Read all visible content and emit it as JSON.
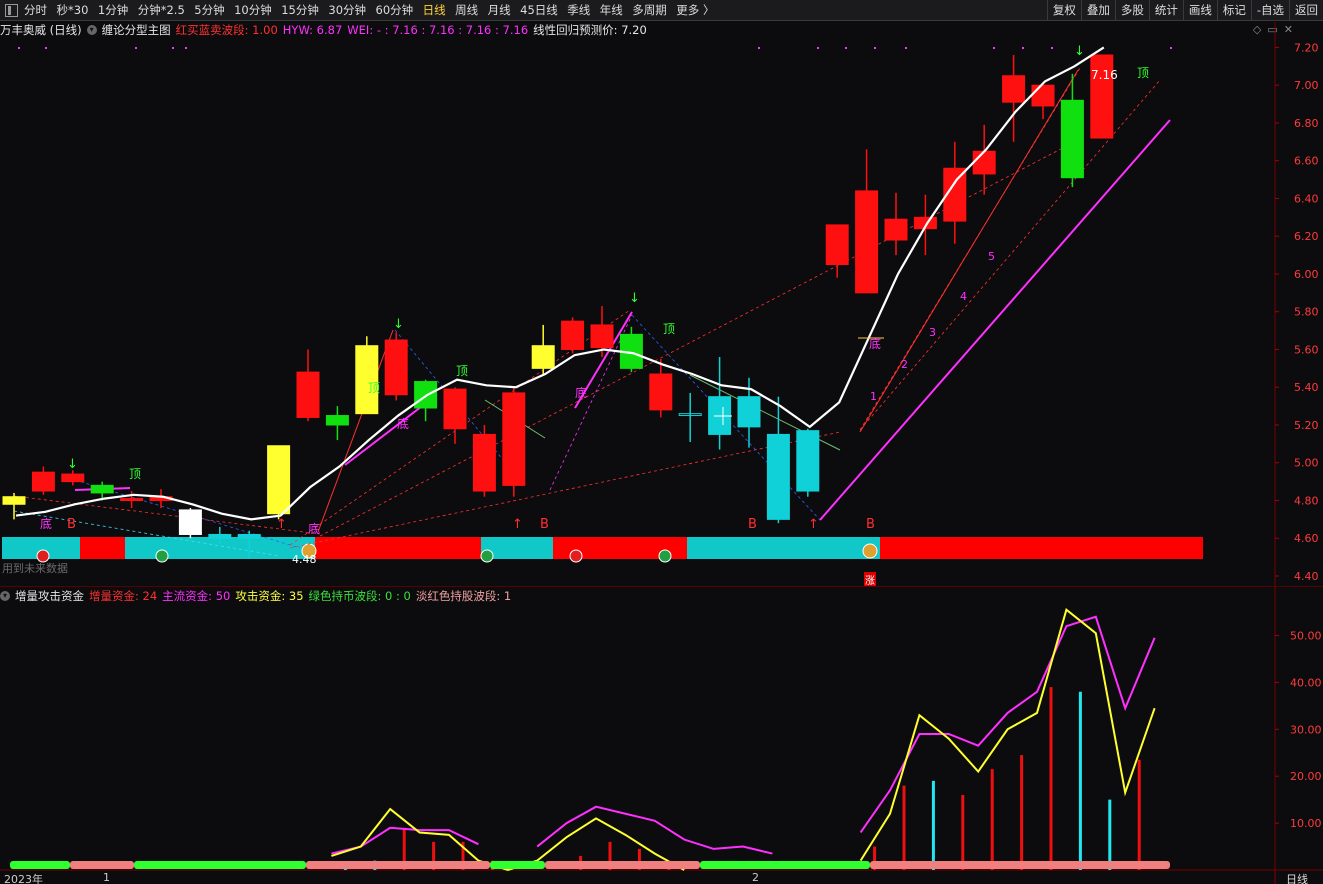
{
  "toolbar": {
    "periods": [
      "分时",
      "秒*30",
      "1分钟",
      "分钟*2.5",
      "5分钟",
      "10分钟",
      "15分钟",
      "30分钟",
      "60分钟",
      "日线",
      "周线",
      "月线",
      "45日线",
      "季线",
      "年线",
      "多周期",
      "更多 〉"
    ],
    "active_period": "日线",
    "right_tools": [
      "复权",
      "叠加",
      "多股",
      "统计",
      "画线",
      "标记",
      "-自选",
      "返回"
    ]
  },
  "title_row": {
    "stock": "万丰奥威 (日线)",
    "indicator": "缠论分型主图",
    "hongmai_label": "红买蓝卖波段: 1.00",
    "hyw_label": "HYW: 6.87",
    "wei_label": "WEI: - : 7.16 : 7.16 : 7.16 : 7.16",
    "forecast_label": "线性回归预测价: 7.20"
  },
  "window_controls": [
    "◇",
    "▭",
    "✕"
  ],
  "future_note": "用到未来数据",
  "rise_tag": "涨",
  "indicator_row": {
    "name": "增量攻击资金",
    "zengliang": "增量资金: 24",
    "zhuliu": "主流资金: 50",
    "gongji": "攻击资金: 35",
    "green_band": "绿色持币波段: 0 : 0",
    "red_band": "淡红色持股波段: 1"
  },
  "price_axis": [
    "7.20",
    "7.00",
    "6.80",
    "6.60",
    "6.40",
    "6.20",
    "6.00",
    "5.80",
    "5.60",
    "5.40",
    "5.20",
    "5.00",
    "4.80",
    "4.60",
    "4.40"
  ],
  "ind_axis": [
    "50.00",
    "40.00",
    "30.00",
    "20.00",
    "10.00"
  ],
  "x_axis": {
    "year": "2023年",
    "m1": "1",
    "m2": "2",
    "period": "日线"
  },
  "annotations": {
    "max_price": "7.16",
    "min_price": "4.48",
    "top": "顶",
    "bottom": "底",
    "buy": "B"
  },
  "colors": {
    "up": "#ff1010",
    "down_green": "#10e010",
    "cyan": "#10d0d8",
    "yellow": "#ffff30",
    "white": "#ffffff",
    "magenta": "#ff30ff"
  },
  "chart_data": {
    "type": "candlestick",
    "price_range": [
      4.4,
      7.25
    ],
    "candles": [
      {
        "o": 4.78,
        "c": 4.82,
        "h": 4.84,
        "l": 4.7,
        "k": "y"
      },
      {
        "o": 4.85,
        "c": 4.95,
        "h": 4.98,
        "l": 4.83,
        "k": "r"
      },
      {
        "o": 4.9,
        "c": 4.94,
        "h": 4.96,
        "l": 4.88,
        "k": "r"
      },
      {
        "o": 4.88,
        "c": 4.84,
        "h": 4.9,
        "l": 4.8,
        "k": "g"
      },
      {
        "o": 4.8,
        "c": 4.81,
        "h": 4.85,
        "l": 4.76,
        "k": "r"
      },
      {
        "o": 4.82,
        "c": 4.8,
        "h": 4.86,
        "l": 4.76,
        "k": "r"
      },
      {
        "o": 4.75,
        "c": 4.62,
        "h": 4.76,
        "l": 4.6,
        "k": "w"
      },
      {
        "o": 4.62,
        "c": 4.6,
        "h": 4.66,
        "l": 4.57,
        "k": "c"
      },
      {
        "o": 4.6,
        "c": 4.62,
        "h": 4.64,
        "l": 4.49,
        "k": "c"
      },
      {
        "o": 4.73,
        "c": 5.09,
        "h": 5.09,
        "l": 4.7,
        "k": "y"
      },
      {
        "o": 5.24,
        "c": 5.48,
        "h": 5.6,
        "l": 5.22,
        "k": "r"
      },
      {
        "o": 5.25,
        "c": 5.2,
        "h": 5.3,
        "l": 5.12,
        "k": "g"
      },
      {
        "o": 5.26,
        "c": 5.62,
        "h": 5.67,
        "l": 5.26,
        "k": "y"
      },
      {
        "o": 5.36,
        "c": 5.65,
        "h": 5.69,
        "l": 5.33,
        "k": "r"
      },
      {
        "o": 5.43,
        "c": 5.29,
        "h": 5.44,
        "l": 5.22,
        "k": "g"
      },
      {
        "o": 5.18,
        "c": 5.39,
        "h": 5.4,
        "l": 5.1,
        "k": "r"
      },
      {
        "o": 4.85,
        "c": 5.15,
        "h": 5.2,
        "l": 4.82,
        "k": "r"
      },
      {
        "o": 4.88,
        "c": 5.37,
        "h": 5.4,
        "l": 4.82,
        "k": "r"
      },
      {
        "o": 5.5,
        "c": 5.62,
        "h": 5.73,
        "l": 5.46,
        "k": "y"
      },
      {
        "o": 5.6,
        "c": 5.75,
        "h": 5.77,
        "l": 5.58,
        "k": "r"
      },
      {
        "o": 5.61,
        "c": 5.73,
        "h": 5.83,
        "l": 5.56,
        "k": "r"
      },
      {
        "o": 5.68,
        "c": 5.5,
        "h": 5.72,
        "l": 5.48,
        "k": "g"
      },
      {
        "o": 5.28,
        "c": 5.47,
        "h": 5.55,
        "l": 5.24,
        "k": "r"
      },
      {
        "o": 5.25,
        "c": 5.26,
        "h": 5.37,
        "l": 5.11,
        "k": "x"
      },
      {
        "o": 5.35,
        "c": 5.15,
        "h": 5.56,
        "l": 5.07,
        "k": "c"
      },
      {
        "o": 5.35,
        "c": 5.19,
        "h": 5.45,
        "l": 5.08,
        "k": "c"
      },
      {
        "o": 5.15,
        "c": 4.7,
        "h": 5.35,
        "l": 4.68,
        "k": "c"
      },
      {
        "o": 5.17,
        "c": 4.85,
        "h": 5.18,
        "l": 4.82,
        "k": "c"
      },
      {
        "o": 6.26,
        "c": 6.05,
        "h": 6.26,
        "l": 5.98,
        "k": "r"
      },
      {
        "o": 6.44,
        "c": 5.9,
        "h": 6.66,
        "l": 5.9,
        "k": "r"
      },
      {
        "o": 6.29,
        "c": 6.18,
        "h": 6.43,
        "l": 6.1,
        "k": "r"
      },
      {
        "o": 6.3,
        "c": 6.24,
        "h": 6.42,
        "l": 6.1,
        "k": "r"
      },
      {
        "o": 6.56,
        "c": 6.28,
        "h": 6.7,
        "l": 6.16,
        "k": "r"
      },
      {
        "o": 6.65,
        "c": 6.53,
        "h": 6.79,
        "l": 6.42,
        "k": "r"
      },
      {
        "o": 7.05,
        "c": 6.91,
        "h": 7.16,
        "l": 6.7,
        "k": "r"
      },
      {
        "o": 7.0,
        "c": 6.89,
        "h": 7.01,
        "l": 6.82,
        "k": "r"
      },
      {
        "o": 6.92,
        "c": 6.51,
        "h": 7.06,
        "l": 6.46,
        "k": "g"
      },
      {
        "o": 7.16,
        "c": 6.72,
        "h": 7.16,
        "l": 6.72,
        "k": "r"
      }
    ],
    "ma_white": [
      4.72,
      4.74,
      4.78,
      4.81,
      4.83,
      4.82,
      4.78,
      4.73,
      4.7,
      4.72,
      4.87,
      4.98,
      5.12,
      5.25,
      5.36,
      5.44,
      5.41,
      5.4,
      5.47,
      5.57,
      5.6,
      5.58,
      5.52,
      5.47,
      5.41,
      5.39,
      5.3,
      5.19,
      5.32,
      5.66,
      6.0,
      6.27,
      6.5,
      6.66,
      6.86,
      7.02,
      7.1,
      7.2
    ],
    "indicator": {
      "range": [
        0,
        58
      ],
      "magenta": [
        null,
        null,
        null,
        null,
        null,
        null,
        null,
        null,
        null,
        null,
        null,
        3.5,
        5,
        9,
        8.5,
        8.5,
        5.5,
        null,
        5,
        10,
        13.5,
        12,
        10.5,
        6.5,
        4.5,
        5,
        3.5,
        null,
        null,
        8,
        17,
        29,
        29,
        26.5,
        33.5,
        38,
        52,
        54,
        34.5,
        49.5
      ],
      "yellow": [
        null,
        null,
        null,
        null,
        null,
        null,
        null,
        null,
        null,
        null,
        null,
        3,
        5,
        13,
        8,
        7.5,
        2,
        0,
        2,
        7,
        11,
        7.5,
        3.5,
        0,
        null,
        null,
        null,
        null,
        null,
        2,
        12,
        33,
        28,
        21,
        30,
        33.5,
        55.5,
        50.5,
        16.5,
        34.5
      ],
      "bars": [
        null,
        null,
        null,
        null,
        null,
        null,
        null,
        null,
        null,
        null,
        null,
        1,
        2,
        9,
        6,
        6,
        2,
        null,
        null,
        3,
        6,
        4.5,
        2,
        null,
        null,
        null,
        null,
        null,
        null,
        5,
        18,
        19,
        16,
        21.5,
        24.5,
        39,
        38,
        15,
        23.5
      ],
      "bar_colors": [
        "r",
        "r",
        "r",
        "r",
        "c",
        "c",
        "r",
        "r",
        "r",
        "r",
        "r",
        "c",
        "c",
        "r",
        "r",
        "r",
        "r",
        "c",
        "r",
        "r",
        "r",
        "r",
        "r",
        "r",
        "r",
        "c",
        "r",
        "r",
        "r",
        "r",
        "r",
        "c",
        "r",
        "r",
        "r",
        "r",
        "c",
        "c",
        "r"
      ]
    },
    "band_bottom": [
      "g",
      "g",
      "p",
      "p",
      "g",
      "g",
      "g",
      "g",
      "g",
      "g",
      "p",
      "p",
      "p",
      "p",
      "p",
      "p",
      "g",
      "g",
      "p",
      "p",
      "p",
      "p",
      "p",
      "g",
      "g",
      "g",
      "g",
      "g",
      "g",
      "p",
      "p",
      "p",
      "p",
      "p",
      "p",
      "p",
      "p",
      "p",
      "p",
      "p"
    ]
  }
}
